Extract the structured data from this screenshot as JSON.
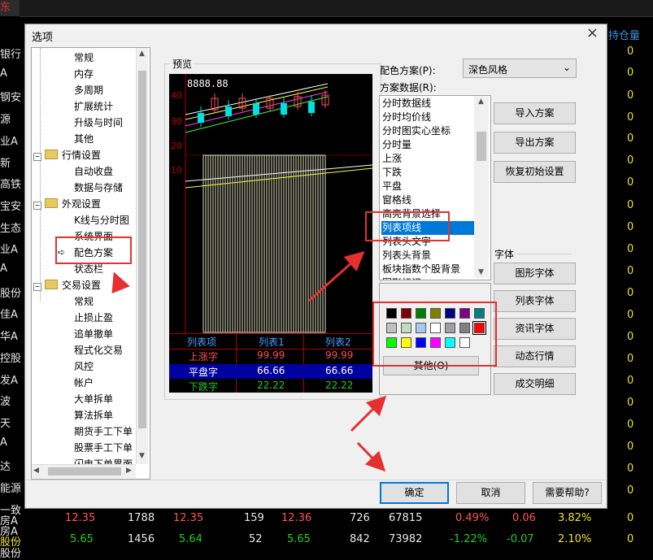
{
  "background": {
    "tab_label": "东牌",
    "column_header": "持仓量",
    "left_names": [
      "银行",
      "A",
      "钢安",
      "源",
      "业A",
      "新",
      "高铁",
      "宝安",
      "生态",
      "业A",
      "A",
      "股份",
      "佳A",
      "华A",
      "控股",
      "发A",
      "波",
      "天",
      "A",
      "达",
      "能源",
      "一致",
      "房A",
      "股份"
    ],
    "right_values": [
      "0",
      "0",
      "0",
      "0",
      "0",
      "0",
      "0",
      "0",
      "0",
      "0",
      "0",
      "0",
      "0",
      "0",
      "0",
      "0",
      "0",
      "0",
      "0",
      "0",
      "0",
      "0",
      "0",
      "0",
      "0",
      "0",
      "0",
      "0"
    ],
    "rows": [
      {
        "name": "房A",
        "price": "12.35",
        "vol": "1788",
        "bid": "12.35",
        "q": "159",
        "ask": "12.36",
        "q2": "726",
        "total": "67815",
        "pct": "0.49%",
        "chg": "0.06",
        "rate": "3.82%",
        "last": "0"
      },
      {
        "name": "股份",
        "price": "5.65",
        "vol": "1456",
        "bid": "5.64",
        "q": "52",
        "ask": "5.65",
        "q2": "842",
        "total": "73982",
        "pct": "-1.22%",
        "chg": "-0.07",
        "rate": "2.10%",
        "last": "0"
      }
    ]
  },
  "dialog": {
    "title": "选项",
    "close": "×",
    "tree": [
      {
        "label": "常规",
        "level": 2
      },
      {
        "label": "内存",
        "level": 2
      },
      {
        "label": "多周期",
        "level": 2
      },
      {
        "label": "扩展统计",
        "level": 2
      },
      {
        "label": "升级与时间",
        "level": 2
      },
      {
        "label": "其他",
        "level": 2
      },
      {
        "label": "行情设置",
        "level": 1
      },
      {
        "label": "自动收盘",
        "level": 2
      },
      {
        "label": "数据与存储",
        "level": 2
      },
      {
        "label": "外观设置",
        "level": 1
      },
      {
        "label": "K线与分时图",
        "level": 2
      },
      {
        "label": "系统界面",
        "level": 2
      },
      {
        "label": "配色方案",
        "level": 2,
        "selected": true
      },
      {
        "label": "状态栏",
        "level": 2
      },
      {
        "label": "交易设置",
        "level": 1
      },
      {
        "label": "常规",
        "level": 2
      },
      {
        "label": "止损止盈",
        "level": 2
      },
      {
        "label": "追单撤单",
        "level": 2
      },
      {
        "label": "程式化交易",
        "level": 2
      },
      {
        "label": "风控",
        "level": 2
      },
      {
        "label": "帐户",
        "level": 2
      },
      {
        "label": "大单拆单",
        "level": 2
      },
      {
        "label": "算法拆单",
        "level": 2
      },
      {
        "label": "期货手工下单",
        "level": 2
      },
      {
        "label": "股票手工下单",
        "level": 2
      },
      {
        "label": "闪电下单界面",
        "level": 2
      }
    ],
    "preview": {
      "label": "预览",
      "price_text": "8888.88",
      "axis": [
        "40",
        "30",
        "20",
        "10"
      ],
      "table_headers": [
        "列表项",
        "列表1",
        "列表2"
      ],
      "table_rows": [
        {
          "label": "上涨字",
          "v1": "99.99",
          "v2": "99.99"
        },
        {
          "label": "平盘字",
          "v1": "66.66",
          "v2": "66.66"
        },
        {
          "label": "下跌字",
          "v1": "22.22",
          "v2": "22.22"
        }
      ]
    },
    "scheme_label": "配色方案(P):",
    "scheme_value": "深色风格",
    "scheme_data_label": "方案数据(R):",
    "scheme_items": [
      "分时数据线",
      "分时均价线",
      "分时图实心坐标",
      "分时量",
      "上涨",
      "下跌",
      "平盘",
      "窗格线",
      "高亮背景选择",
      "列表项线",
      "列表头文字",
      "列表头背景",
      "板块指数个股背景",
      "图形标记"
    ],
    "selected_scheme_index": 9,
    "palette_colors": [
      "#000000",
      "#800000",
      "#008000",
      "#808000",
      "#000080",
      "#800080",
      "#008080",
      "#c0c0c0",
      "#c0dcc0",
      "#a6caf0",
      "#ffffff",
      "#a0a0a4",
      "#808080",
      "#ff0000",
      "#00ff00",
      "#ffff00",
      "#0000ff",
      "#ff00ff",
      "#00ffff",
      "#ffffff"
    ],
    "palette_selected_index": 13,
    "other_button": "其他(O)",
    "buttons_top": [
      "导入方案",
      "导出方案",
      "恢复初始设置"
    ],
    "font_group_label": "字体",
    "font_buttons": [
      "图形字体",
      "列表字体",
      "资讯字体",
      "动态行情",
      "成交明细"
    ],
    "ok": "确定",
    "cancel": "取消",
    "help": "需要帮助?"
  },
  "colors": {
    "accent": "#0078d7",
    "annotation_red": "#e53030",
    "up": "#ff5555",
    "down": "#20d020",
    "flat_bg": "#0000a0"
  }
}
